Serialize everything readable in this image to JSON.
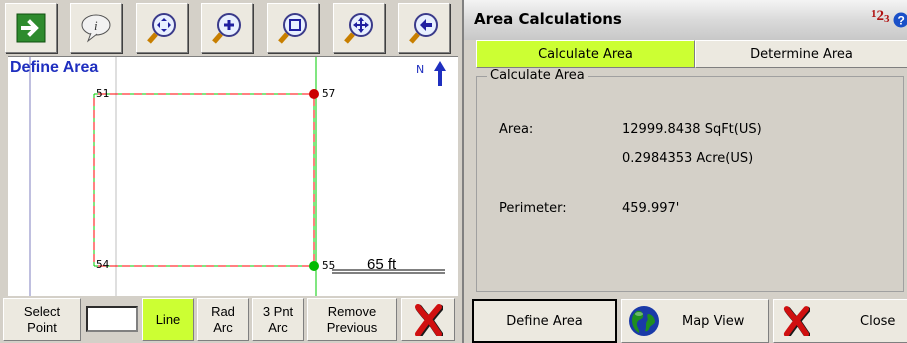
{
  "toolbar": {
    "buttons": [
      {
        "name": "accept-arrow-icon"
      },
      {
        "name": "info-bubble-icon"
      },
      {
        "name": "zoom-extents-icon"
      },
      {
        "name": "zoom-in-icon"
      },
      {
        "name": "zoom-window-icon"
      },
      {
        "name": "pan-icon"
      },
      {
        "name": "back-icon"
      }
    ]
  },
  "map": {
    "title": "Define Area",
    "north_label": "N",
    "points": {
      "p51": "51",
      "p57": "57",
      "p54": "54",
      "p55": "55"
    },
    "scale_label": "65 ft",
    "colors": {
      "line": "#ff0000",
      "dash": "#00cc00",
      "grid": "#00cc00",
      "start_point": "#cc0000",
      "end_point": "#00bb00",
      "north_arrow": "#1f2fbf"
    }
  },
  "bottom_bar": {
    "select_point": "Select\nPoint",
    "input_value": "",
    "line": "Line",
    "rad_arc": "Rad\nArc",
    "three_pnt_arc": "3 Pnt\nArc",
    "remove_previous": "Remove\nPrevious",
    "cancel_icon": "red-x-icon"
  },
  "dialog": {
    "title": "Area Calculations",
    "title_badge": "1",
    "title_badge_sub": "2",
    "title_badge_3": "3",
    "tabs": {
      "calculate_area": "Calculate Area",
      "determine_area": "Determine Area"
    },
    "group_title": "Calculate Area",
    "area_label": "Area:",
    "area_sqft": "12999.8438 SqFt(US)",
    "area_acre": "0.2984353 Acre(US)",
    "perimeter_label": "Perimeter:",
    "perimeter_value": "459.997'",
    "buttons": {
      "define_area": "Define Area",
      "map_view": "Map View",
      "close": "Close"
    },
    "accent": "#ccff33"
  }
}
